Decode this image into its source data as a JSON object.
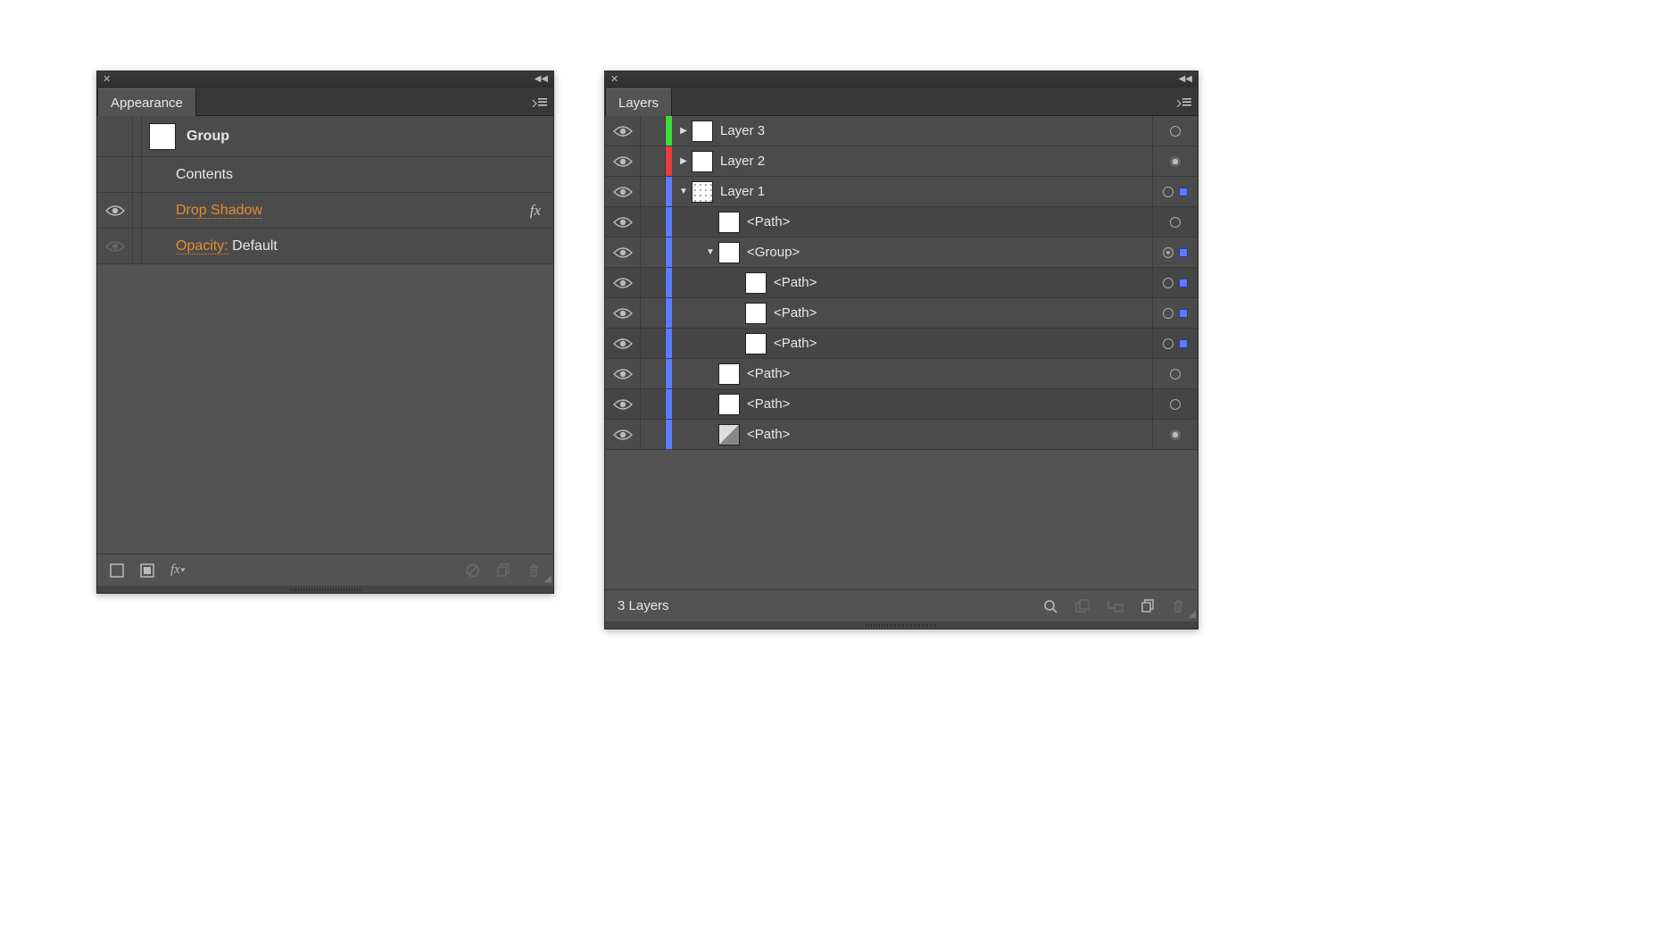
{
  "appearance": {
    "title": "Appearance",
    "selection_label": "Group",
    "contents_label": "Contents",
    "effect_label": "Drop Shadow",
    "opacity_label": "Opacity:",
    "opacity_value": "Default"
  },
  "layers": {
    "title": "Layers",
    "status": "3 Layers",
    "rows": [
      {
        "label": "Layer 3",
        "color": "#3fdc3f",
        "expand": "closed",
        "indent": 0,
        "thumb": "white",
        "target": "open",
        "sel": false,
        "dim": false
      },
      {
        "label": "Layer 2",
        "color": "#e63c3c",
        "expand": "closed",
        "indent": 0,
        "thumb": "white",
        "target": "filled",
        "sel": false,
        "dim": false
      },
      {
        "label": "Layer 1",
        "color": "#5b7cff",
        "expand": "open",
        "indent": 0,
        "thumb": "dots",
        "target": "open",
        "sel": true,
        "dim": false
      },
      {
        "label": "<Path>",
        "color": "#5b7cff",
        "expand": "",
        "indent": 1,
        "thumb": "white",
        "target": "open",
        "sel": false,
        "dim": true
      },
      {
        "label": "<Group>",
        "color": "#5b7cff",
        "expand": "open",
        "indent": 1,
        "thumb": "white",
        "target": "double",
        "sel": true,
        "dim": false
      },
      {
        "label": "<Path>",
        "color": "#5b7cff",
        "expand": "",
        "indent": 2,
        "thumb": "white",
        "target": "open",
        "sel": true,
        "dim": true
      },
      {
        "label": "<Path>",
        "color": "#5b7cff",
        "expand": "",
        "indent": 2,
        "thumb": "white",
        "target": "open",
        "sel": true,
        "dim": false
      },
      {
        "label": "<Path>",
        "color": "#5b7cff",
        "expand": "",
        "indent": 2,
        "thumb": "white",
        "target": "open",
        "sel": true,
        "dim": true
      },
      {
        "label": "<Path>",
        "color": "#5b7cff",
        "expand": "",
        "indent": 1,
        "thumb": "white",
        "target": "open",
        "sel": false,
        "dim": false
      },
      {
        "label": "<Path>",
        "color": "#5b7cff",
        "expand": "",
        "indent": 1,
        "thumb": "white",
        "target": "open",
        "sel": false,
        "dim": true
      },
      {
        "label": "<Path>",
        "color": "#5b7cff",
        "expand": "",
        "indent": 1,
        "thumb": "grad",
        "target": "filled",
        "sel": false,
        "dim": false
      }
    ]
  }
}
